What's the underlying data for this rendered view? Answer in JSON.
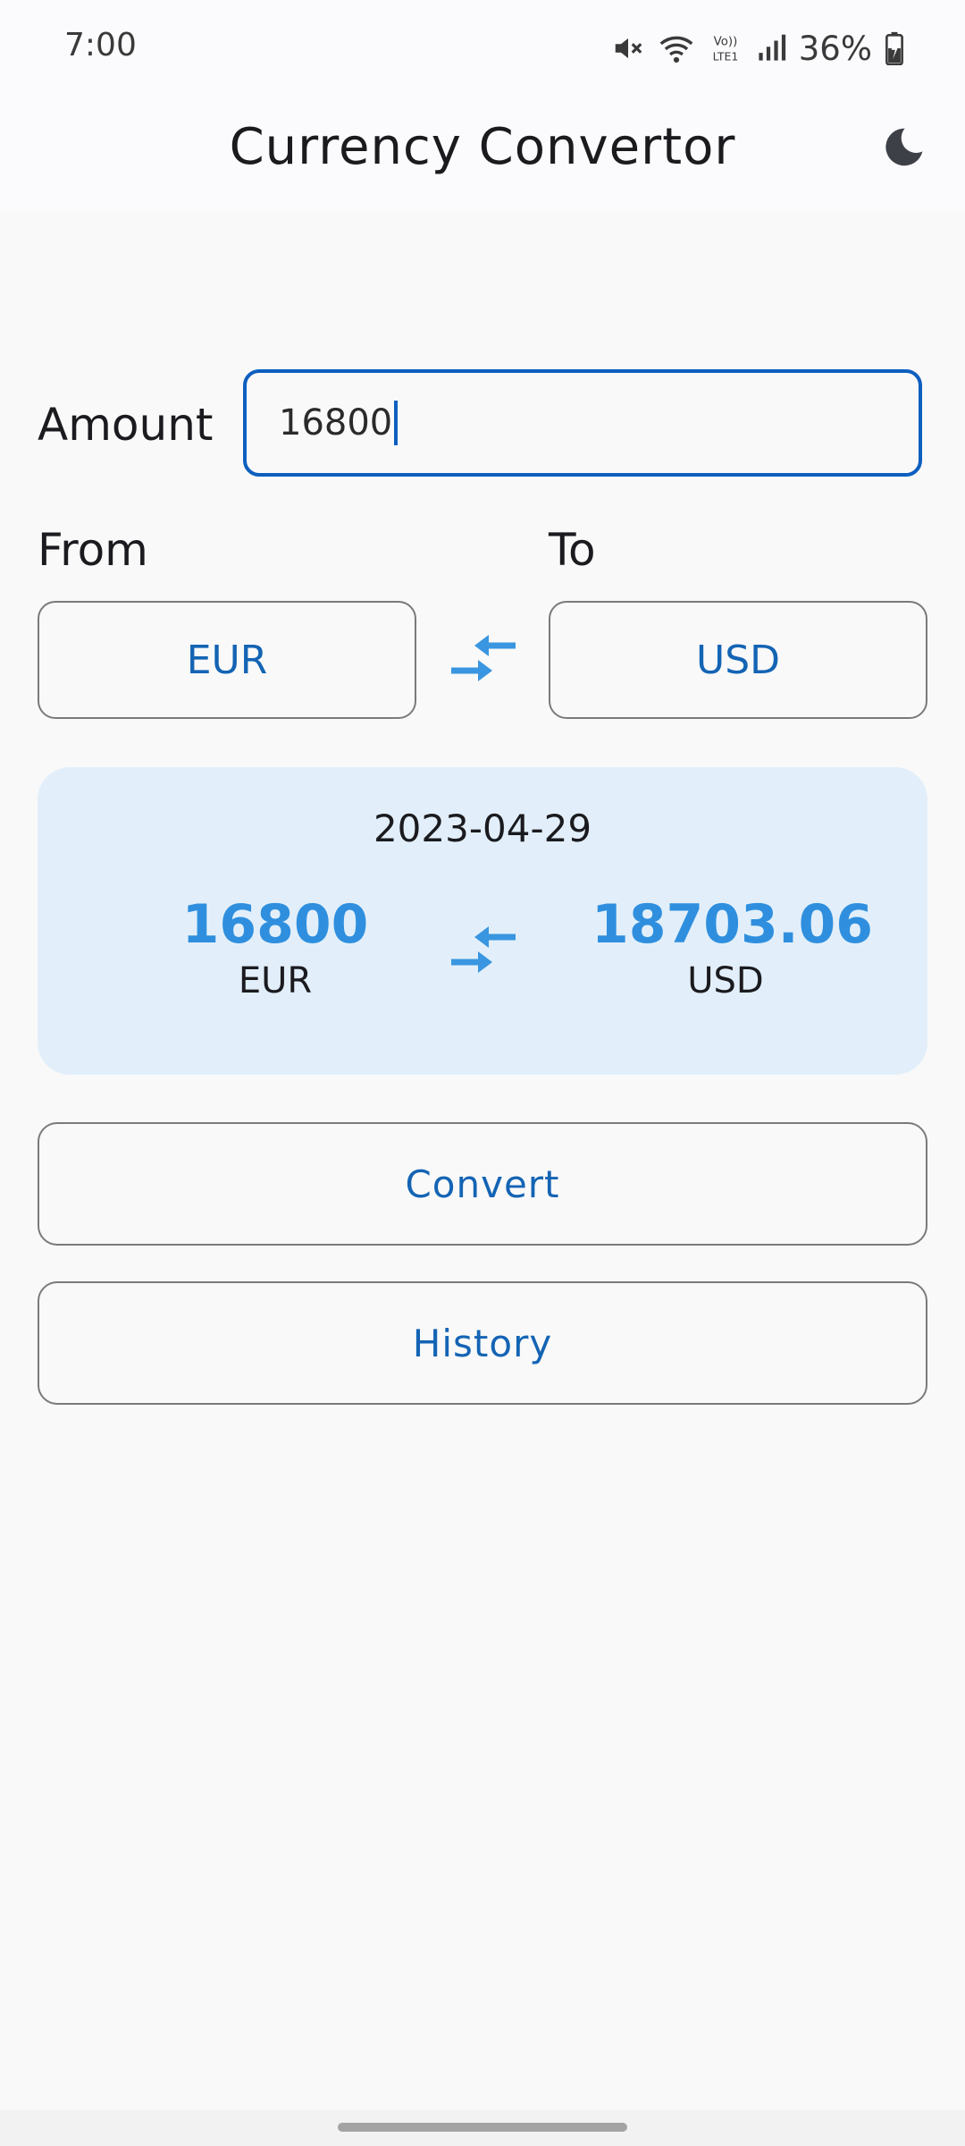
{
  "status_bar": {
    "time": "7:00",
    "battery": "36%",
    "icons": [
      "mute-icon",
      "wifi-icon",
      "volte-icon",
      "signal-icon",
      "battery-charging-icon"
    ],
    "volte_label": "Vo)) LTE1"
  },
  "app_bar": {
    "title": "Currency Convertor",
    "theme_icon": "moon-icon"
  },
  "form": {
    "amount_label": "Amount",
    "amount_value": "16800",
    "from_label": "From",
    "to_label": "To",
    "from_currency": "EUR",
    "to_currency": "USD",
    "swap_icon": "swap-arrows-icon"
  },
  "result": {
    "date": "2023-04-29",
    "from_amount": "16800",
    "from_code": "EUR",
    "to_amount": "18703.06",
    "to_code": "USD"
  },
  "actions": {
    "convert_label": "Convert",
    "history_label": "History"
  },
  "colors": {
    "accent": "#1464b4",
    "focus_border": "#0d5fbf",
    "result_value": "#2f8fde",
    "result_card_bg": "#e2effa",
    "swap_icon": "#3a96e0"
  }
}
